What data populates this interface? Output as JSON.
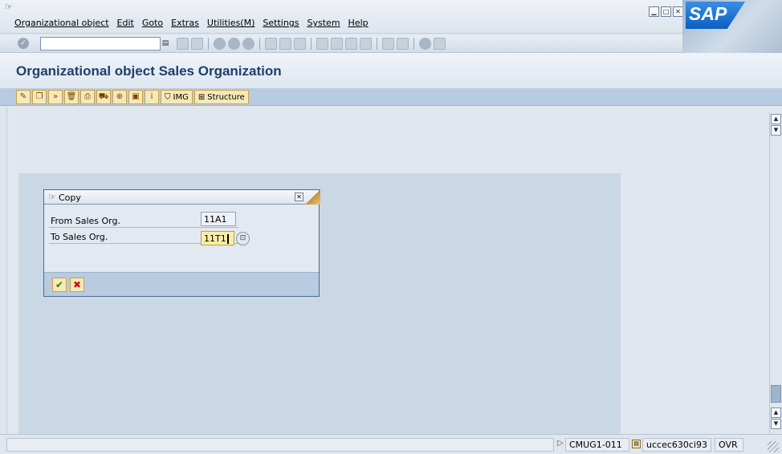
{
  "menubar": {
    "items": [
      "Organizational object",
      "Edit",
      "Goto",
      "Extras",
      "Utilities(M)",
      "Settings",
      "System",
      "Help"
    ],
    "window_controls": [
      "minimize",
      "maximize",
      "close"
    ],
    "logo_text": "SAP"
  },
  "toolbar": {
    "command_field_value": "",
    "icons": [
      "back",
      "save",
      "exit",
      "cancel",
      "cancel-red",
      "print",
      "find",
      "find-next",
      "first-page",
      "previous-page",
      "next-page",
      "last-page",
      "create-session",
      "shortcut",
      "help",
      "layout"
    ]
  },
  "title": "Organizational object Sales Organization",
  "app_toolbar": {
    "icon_buttons": [
      "edit",
      "copy",
      "copy-org-object",
      "delete",
      "check",
      "transport",
      "reference",
      "overview",
      "info"
    ],
    "img_label": "IMG",
    "structure_label": "Structure"
  },
  "dialog": {
    "title": "Copy",
    "rows": [
      {
        "label": "From Sales Org.",
        "value": "11A1"
      },
      {
        "label": "To Sales Org.",
        "value": "11T1"
      }
    ],
    "buttons": [
      "continue",
      "cancel"
    ]
  },
  "statusbar": {
    "message": "",
    "system": "CMUG1-011",
    "server": "uccec630ci93",
    "mode": "OVR"
  },
  "colors": {
    "title_text": "#1e3f6a",
    "app_toolbar_bg": "#b9cbe0",
    "input_bg": "#f9eda6"
  }
}
